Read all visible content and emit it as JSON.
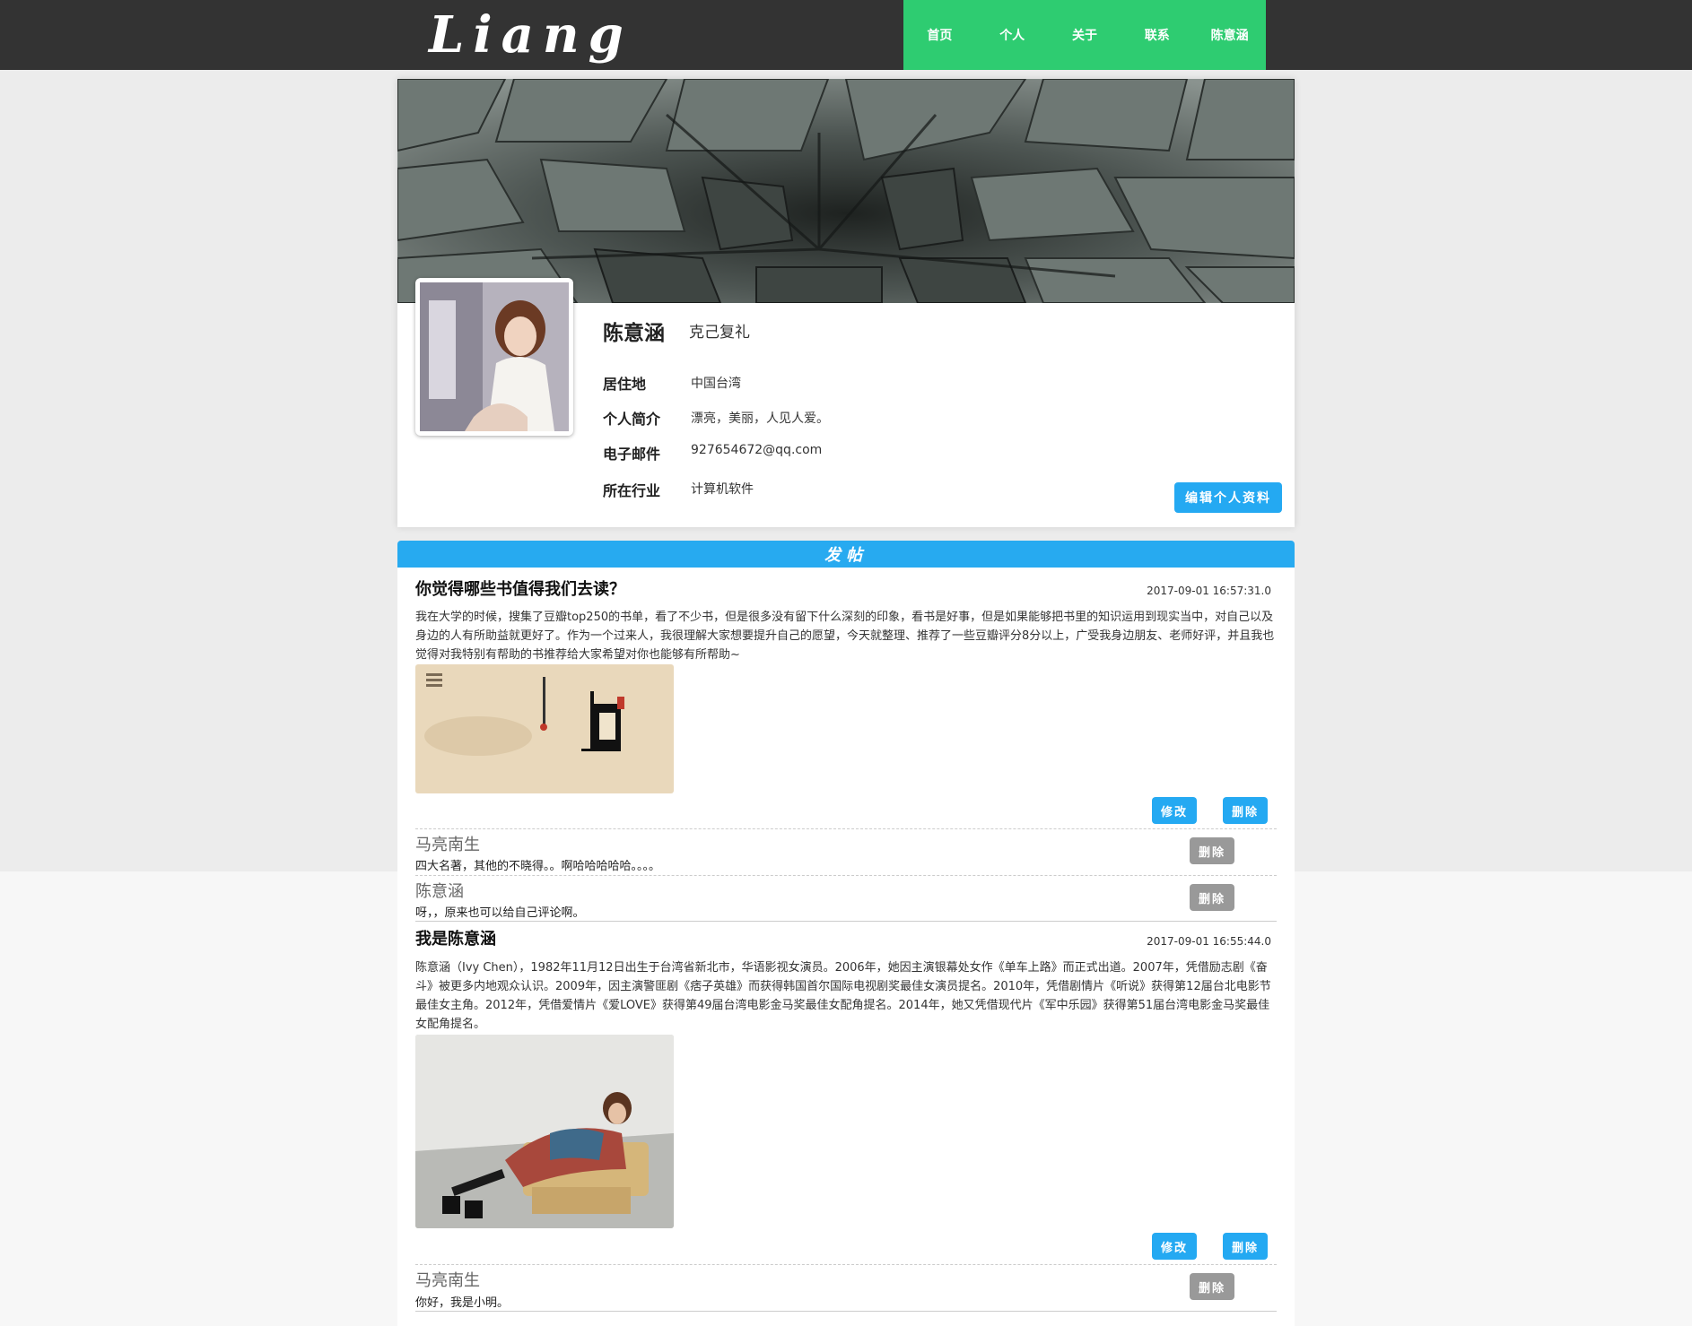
{
  "header": {
    "logo_text": "Liang",
    "nav": [
      "首页",
      "个人",
      "关于",
      "联系",
      "陈意涵"
    ]
  },
  "profile": {
    "name": "陈意涵",
    "motto": "克己复礼",
    "fields": [
      {
        "label": "居住地",
        "value": "中国台湾"
      },
      {
        "label": "个人简介",
        "value": "漂亮，美丽，人见人爱。"
      },
      {
        "label": "电子邮件",
        "value": "927654672@qq.com"
      },
      {
        "label": "所在行业",
        "value": "计算机软件"
      }
    ],
    "edit_label": "编辑个人资料"
  },
  "post_bar_label": "发帖",
  "posts": [
    {
      "title": "你觉得哪些书值得我们去读？",
      "date": "2017-09-01 16:57:31.0",
      "body": "我在大学的时候，搜集了豆瓣top250的书单，看了不少书，但是很多没有留下什么深刻的印象，看书是好事，但是如果能够把书里的知识运用到现实当中，对自己以及身边的人有所助益就更好了。作为一个过来人，我很理解大家想要提升自己的愿望，今天就整理、推荐了一些豆瓣评分8分以上，广受我身边朋友、老师好评，并且我也觉得对我特别有帮助的书推荐给大家希望对你也能够有所帮助~",
      "edit_label": "修改",
      "delete_label": "删除",
      "comments": [
        {
          "author": "马亮南生",
          "text": "四大名著，其他的不晓得。。啊哈哈哈哈哈。。。。",
          "delete_label": "删除"
        },
        {
          "author": "陈意涵",
          "text": "呀，，原来也可以给自己评论啊。",
          "delete_label": "删除"
        }
      ]
    },
    {
      "title": "我是陈意涵",
      "date": "2017-09-01 16:55:44.0",
      "body": "陈意涵（Ivy Chen），1982年11月12日出生于台湾省新北市，华语影视女演员。2006年，她因主演银幕处女作《单车上路》而正式出道。2007年，凭借励志剧《奋斗》被更多内地观众认识。2009年，因主演警匪剧《痞子英雄》而获得韩国首尔国际电视剧奖最佳女演员提名。2010年，凭借剧情片《听说》获得第12届台北电影节最佳女主角。2012年，凭借爱情片《爱LOVE》获得第49届台湾电影金马奖最佳女配角提名。2014年，她又凭借现代片《军中乐园》获得第51届台湾电影金马奖最佳女配角提名。",
      "edit_label": "修改",
      "delete_label": "删除",
      "comments": [
        {
          "author": "马亮南生",
          "text": "你好，我是小明。",
          "delete_label": "删除"
        }
      ]
    }
  ],
  "colors": {
    "topbar": "#333333",
    "nav": "#2ecc71",
    "accent_blue": "#24a9f2",
    "gray_button": "#999999"
  }
}
